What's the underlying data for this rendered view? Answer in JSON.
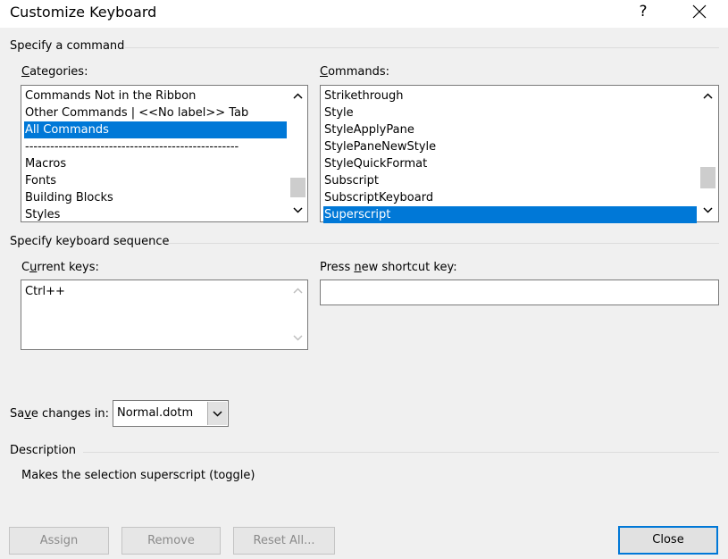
{
  "window": {
    "title": "Customize Keyboard",
    "help_glyph": "?"
  },
  "specify_command": {
    "group_label": "Specify a command",
    "categories": {
      "label_underlined": "C",
      "label_rest": "ategories:",
      "items": [
        "Commands Not in the Ribbon",
        "Other Commands | <<No label>> Tab",
        "All Commands",
        "---------------------------------------------------",
        "Macros",
        "Fonts",
        "Building Blocks",
        "Styles"
      ],
      "selected_index": 2
    },
    "commands": {
      "label_underlined": "C",
      "label_rest": "ommands:",
      "items": [
        "Strikethrough",
        "Style",
        "StyleApplyPane",
        "StylePaneNewStyle",
        "StyleQuickFormat",
        "Subscript",
        "SubscriptKeyboard",
        "Superscript"
      ],
      "selected_index": 7
    }
  },
  "keyboard_sequence": {
    "group_label": "Specify keyboard sequence",
    "current_keys": {
      "label_pre": "C",
      "label_underlined": "u",
      "label_rest": "rrent keys:",
      "items": [
        "Ctrl++"
      ]
    },
    "new_shortcut": {
      "label_pre": "Press ",
      "label_underlined": "n",
      "label_rest": "ew shortcut key:",
      "value": ""
    }
  },
  "save_changes": {
    "label_pre": "Sa",
    "label_underlined": "v",
    "label_rest": "e changes in:",
    "value": "Normal.dotm"
  },
  "description": {
    "group_label": "Description",
    "text": "Makes the selection superscript (toggle)"
  },
  "buttons": {
    "assign": "Assign",
    "remove": "Remove",
    "reset_all": "Reset All...",
    "close": "Close"
  },
  "colors": {
    "selection": "#0078d7",
    "dialog_bg": "#f0f0f0"
  }
}
